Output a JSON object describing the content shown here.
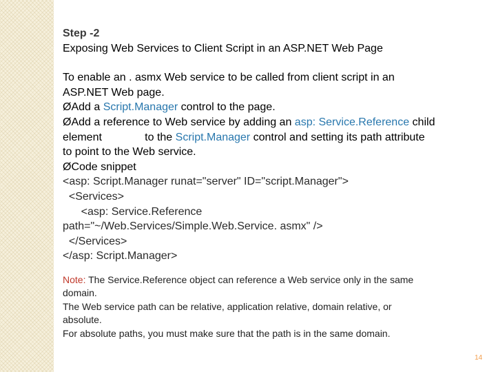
{
  "slide": {
    "step": "Step -2",
    "title": "Exposing Web Services to Client Script in an ASP.NET Web Page",
    "intro": [
      "To enable an . asmx Web service to be called from client script in an",
      "ASP.NET Web page."
    ],
    "bullet_marker": "Ø",
    "bullet1": {
      "pre": "Add a ",
      "hl": "Script.Manager",
      "post": " control to the page."
    },
    "bullet2": {
      "pre": "Add a reference to Web service by adding an ",
      "hl1": "asp: Service.Reference",
      "mid1": " child",
      "line2_pre": "element              to the ",
      "hl2": "Script.Manager",
      "line2_post": " control and setting its path attribute",
      "line3": "to point to the Web service."
    },
    "bullet3": "Code snippet",
    "code": [
      "<asp: Script.Manager runat=\"server\" ID=\"script.Manager\">",
      "  <Services>",
      "      <asp: Service.Reference",
      "path=\"~/Web.Services/Simple.Web.Service. asmx\" />",
      "  </Services>",
      "</asp: Script.Manager>"
    ],
    "note": {
      "label": "Note:",
      "line1_rest": " The Service.Reference object can reference a Web service only in the same",
      "lines": [
        "domain.",
        "The Web service path can be relative, application relative, domain relative, or",
        "absolute.",
        "For absolute paths, you must make sure that the path is in the same domain."
      ]
    },
    "page_number": "14"
  },
  "colors": {
    "highlight": "#2877ad",
    "note_label": "#c0392b",
    "page_number": "#f29c4a",
    "side_band": "#f6f0dc"
  }
}
